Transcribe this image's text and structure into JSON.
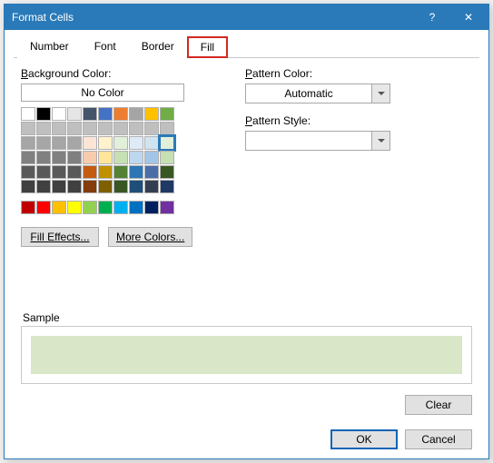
{
  "dialog": {
    "title": "Format Cells",
    "help_icon": "?",
    "close_icon": "✕"
  },
  "tabs": {
    "items": [
      {
        "label": "Number"
      },
      {
        "label": "Font"
      },
      {
        "label": "Border"
      },
      {
        "label": "Fill"
      }
    ],
    "active_index": 3
  },
  "fill": {
    "bg_label": "Background Color:",
    "no_color": "No Color",
    "fill_effects_btn": "Fill Effects...",
    "more_colors_btn": "More Colors...",
    "pattern_color_label": "Pattern Color:",
    "pattern_color_value": "Automatic",
    "pattern_style_label": "Pattern Style:",
    "pattern_style_value": ""
  },
  "palette": {
    "rows": [
      [
        "empty",
        "#000000",
        "#ffffff",
        "#e7e6e6",
        "#44546a",
        "#4472c4",
        "#ed7d31",
        "#a5a5a5",
        "#ffc000",
        "#70ad47"
      ],
      [
        "#bfbfbf",
        "#bfbfbf",
        "#bfbfbf",
        "#bfbfbf",
        "#bfbfbf",
        "#bfbfbf",
        "#bfbfbf",
        "#bfbfbf",
        "#bfbfbf",
        "#bfbfbf"
      ],
      [
        "#a6a6a6",
        "#a6a6a6",
        "#a6a6a6",
        "#a6a6a6",
        "#fbe5d6",
        "#fff2cc",
        "#e2f0d9",
        "#deebf7",
        "#d0e3f1",
        "#e2efda"
      ],
      [
        "#808080",
        "#808080",
        "#808080",
        "#808080",
        "#f8cbad",
        "#ffe699",
        "#c5e0b4",
        "#bdd7ee",
        "#a2c5e8",
        "#c6e0b4"
      ],
      [
        "#595959",
        "#595959",
        "#595959",
        "#595959",
        "#c55a11",
        "#bf9000",
        "#548235",
        "#2e75b6",
        "#4b6ea9",
        "#385723"
      ],
      [
        "#404040",
        "#404040",
        "#404040",
        "#404040",
        "#833c0c",
        "#7f6000",
        "#385723",
        "#1f4e79",
        "#333f50",
        "#203864"
      ]
    ],
    "selected": [
      2,
      9
    ],
    "standard": [
      "#c00000",
      "#ff0000",
      "#ffc000",
      "#ffff00",
      "#92d050",
      "#00b050",
      "#00b0f0",
      "#0070c0",
      "#002060",
      "#7030a0"
    ]
  },
  "sample": {
    "label": "Sample",
    "color": "#d9e6c7"
  },
  "buttons": {
    "clear": "Clear",
    "ok": "OK",
    "cancel": "Cancel"
  }
}
